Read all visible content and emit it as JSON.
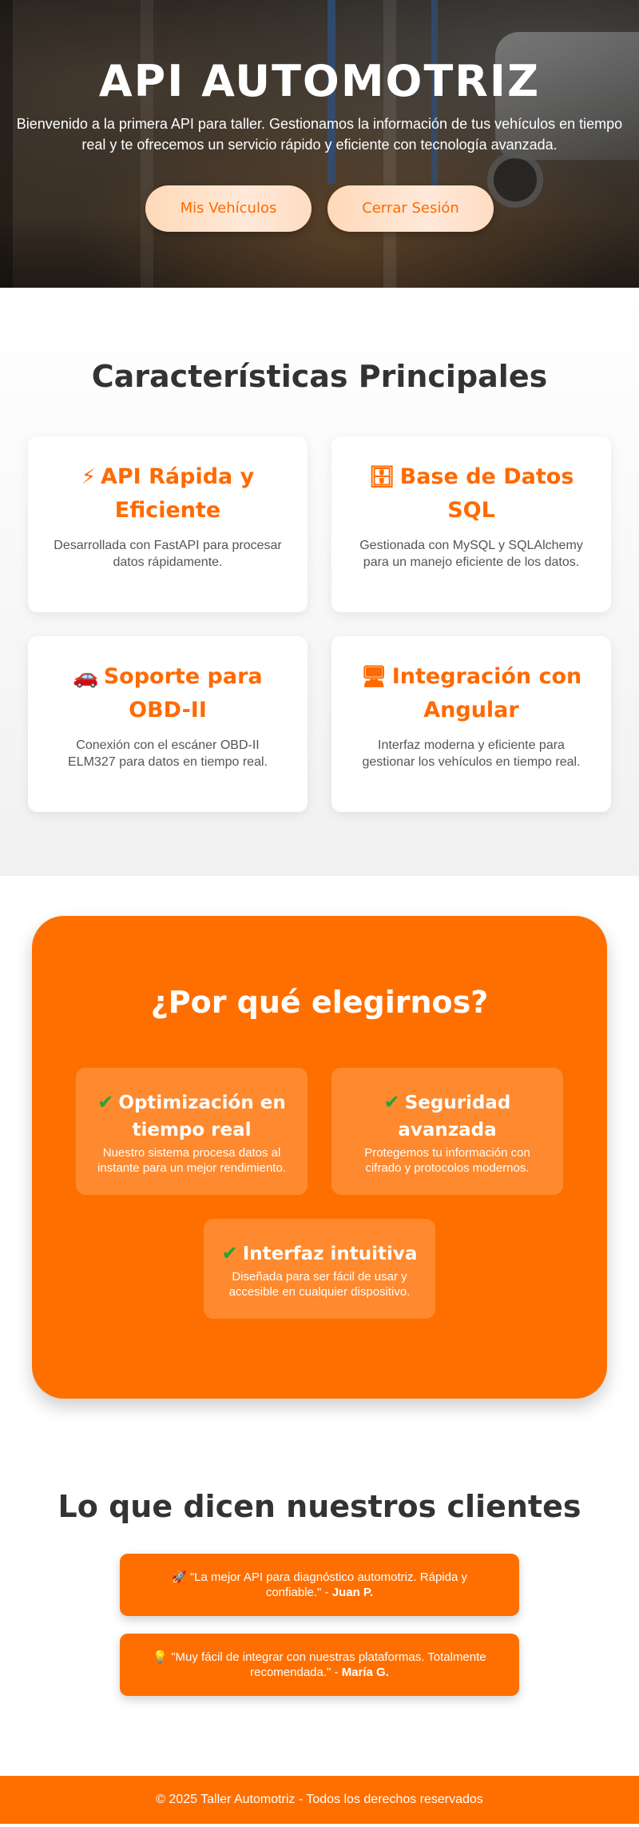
{
  "hero": {
    "title": "API AUTOMOTRIZ",
    "subtitle": "Bienvenido a la primera API para taller. Gestionamos la información de tus vehículos en tiempo real y te ofrecemos un servicio rápido y eficiente con tecnología avanzada.",
    "buttons": [
      "Mis Vehículos",
      "Cerrar Sesión"
    ]
  },
  "features": {
    "title": "Características Principales",
    "items": [
      {
        "icon": "⚡",
        "icon_name": "lightning-icon",
        "title": "API Rápida y Eficiente",
        "text": "Desarrollada con FastAPI para procesar datos rápidamente."
      },
      {
        "icon": "🗄",
        "icon_name": "database-icon",
        "title": "Base de Datos SQL",
        "text": "Gestionada con MySQL y SQLAlchemy para un manejo eficiente de los datos."
      },
      {
        "icon": "🚗",
        "icon_name": "car-icon",
        "title": "Soporte para OBD-II",
        "text": "Conexión con el escáner OBD-II ELM327 para datos en tiempo real."
      },
      {
        "icon": "🖥",
        "icon_name": "monitor-icon",
        "title": "Integración con Angular",
        "text": "Interfaz moderna y eficiente para gestionar los vehículos en tiempo real."
      }
    ]
  },
  "why": {
    "title": "¿Por qué elegirnos?",
    "items": [
      {
        "title": "Optimización en tiempo real",
        "text": "Nuestro sistema procesa datos al instante para un mejor rendimiento."
      },
      {
        "title": "Seguridad avanzada",
        "text": "Protegemos tu información con cifrado y protocolos modernos."
      },
      {
        "title": "Interfaz intuitiva",
        "text": "Diseñada para ser fácil de usar y accesible en cualquier dispositivo."
      }
    ],
    "check": "✔"
  },
  "testimonials": {
    "title": "Lo que dicen nuestros clientes",
    "items": [
      {
        "icon": "🚀",
        "text": "\"La mejor API para diagnóstico automotriz. Rápida y confiable.\" - ",
        "author": "Juan P."
      },
      {
        "icon": "💡",
        "text": "\"Muy fácil de integrar con nuestras plataformas. Totalmente recomendada.\" - ",
        "author": "María G."
      }
    ]
  },
  "footer": {
    "text": "© 2025 Taller Automotriz - Todos los derechos reservados"
  },
  "colors": {
    "accent": "#ff6f00",
    "feature_title": "#ff6a00",
    "check": "#1ea53c"
  }
}
